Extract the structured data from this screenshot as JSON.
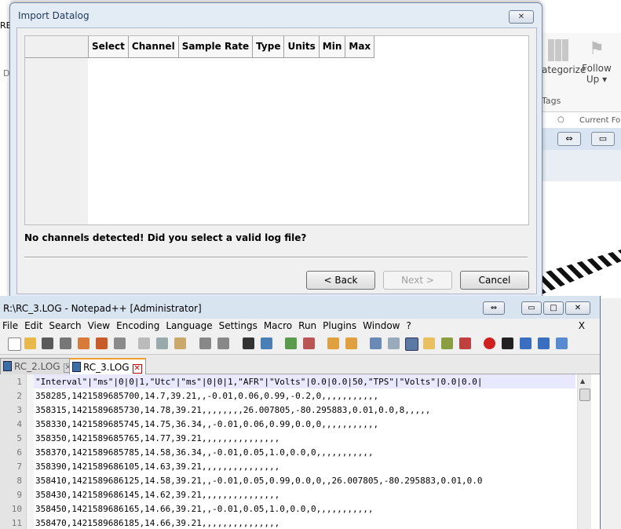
{
  "background": {
    "left_fragment_text": "RE",
    "left_fragment_d": "D",
    "ribbon": {
      "categorize_label": "ategorize",
      "follow_label": "Follow",
      "follow_sub": "Up ▾",
      "tags_label": "Tags",
      "current_label": "Current Fo"
    }
  },
  "dialog": {
    "title": "Import Datalog",
    "close_glyph": "✕",
    "columns": [
      "Select",
      "Channel",
      "Sample Rate",
      "Type",
      "Units",
      "Min",
      "Max"
    ],
    "message": "No channels detected! Did you select a valid log file?",
    "buttons": {
      "back": "< Back",
      "next": "Next >",
      "cancel": "Cancel"
    }
  },
  "notepad": {
    "title": "R:\\RC_3.LOG - Notepad++ [Administrator]",
    "menu": [
      "File",
      "Edit",
      "Search",
      "View",
      "Encoding",
      "Language",
      "Settings",
      "Macro",
      "Run",
      "Plugins",
      "Window",
      "?"
    ],
    "menu_close": "X",
    "tabs": [
      {
        "label": "RC_2.LOG",
        "active": false
      },
      {
        "label": "RC_3.LOG",
        "active": true
      }
    ],
    "lines": [
      "\"Interval\"|\"ms\"|0|0|1,\"Utc\"|\"ms\"|0|0|1,\"AFR\"|\"Volts\"|0.0|0.0|50,\"TPS\"|\"Volts\"|0.0|0.0|",
      "358285,1421589685700,14.7,39.21,,-0.01,0.06,0.99,-0.2,0,,,,,,,,,,,",
      "358315,1421589685730,14.78,39.21,,,,,,,,26.007805,-80.295883,0.01,0.0,8,,,,,",
      "358330,1421589685745,14.75,36.34,,-0.01,0.06,0.99,0.0,0,,,,,,,,,,,",
      "358350,1421589685765,14.77,39.21,,,,,,,,,,,,,,,",
      "358370,1421589685785,14.58,36.34,,-0.01,0.05,1.0,0.0,0,,,,,,,,,,,",
      "358390,1421589686105,14.63,39.21,,,,,,,,,,,,,,,",
      "358410,1421589686125,14.58,39.21,,-0.01,0.05,0.99,0.0,0,,26.007805,-80.295883,0.01,0.0",
      "358430,1421589686145,14.62,39.21,,,,,,,,,,,,,,,",
      "358450,1421589686165,14.66,39.21,,-0.01,0.05,1.0,0.0,0,,,,,,,,,,,",
      "358470,1421589686185,14.66,39.21,,,,,,,,,,,,,,,"
    ],
    "line_numbers": [
      "1",
      "2",
      "3",
      "4",
      "5",
      "6",
      "7",
      "8",
      "9",
      "10",
      "11"
    ]
  }
}
